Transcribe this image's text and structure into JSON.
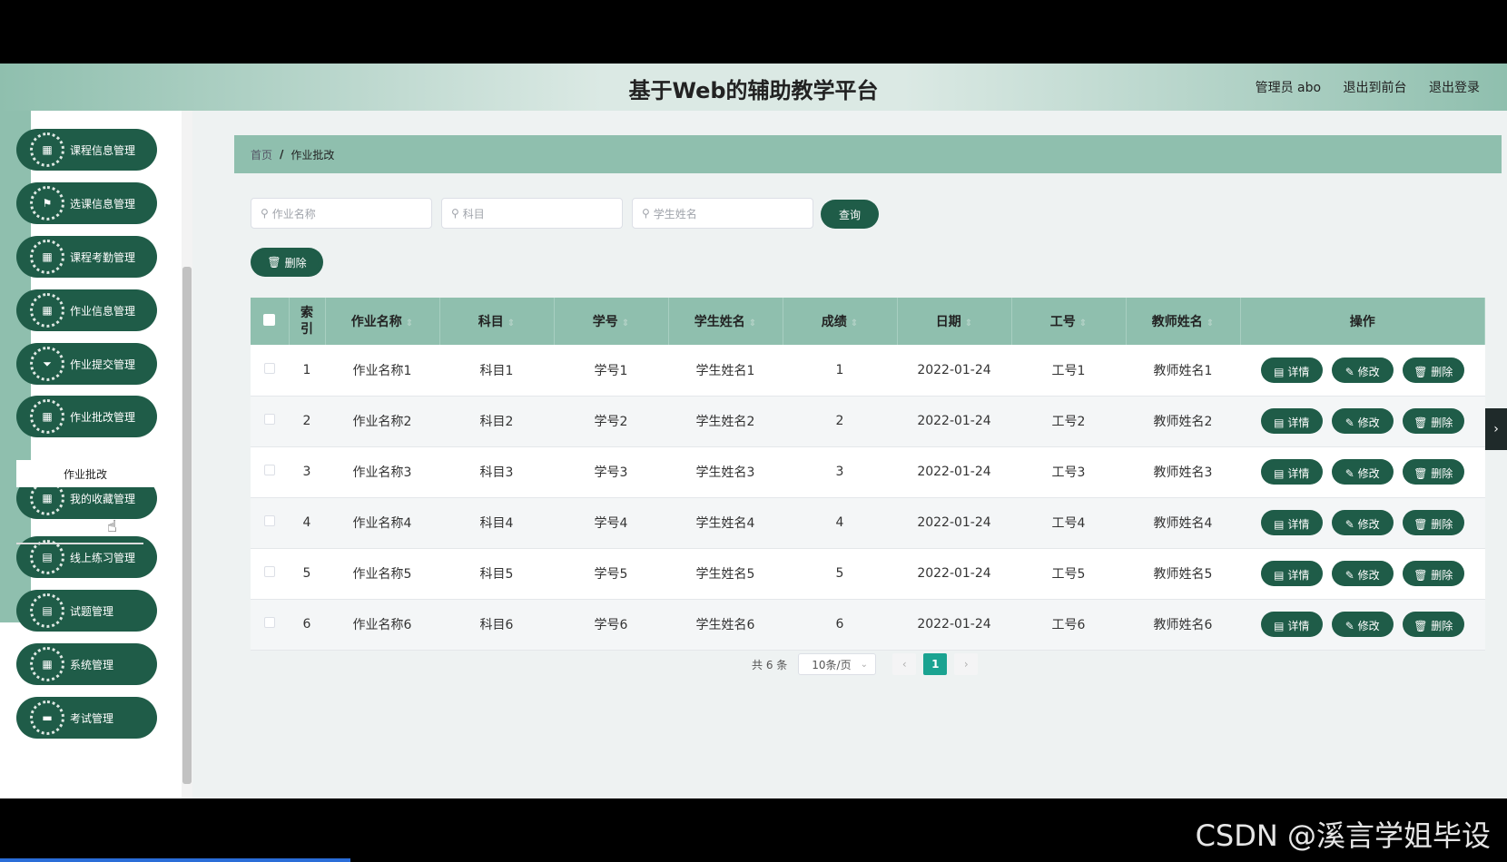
{
  "header": {
    "title": "基于Web的辅助教学平台",
    "user": "管理员 abo",
    "exit_front": "退出到前台",
    "logout": "退出登录"
  },
  "sidebar": {
    "items": [
      {
        "label": "课程信息管理",
        "icon": "grid-icon"
      },
      {
        "label": "选课信息管理",
        "icon": "flag-icon"
      },
      {
        "label": "课程考勤管理",
        "icon": "grid-icon"
      },
      {
        "label": "作业信息管理",
        "icon": "grid-icon"
      },
      {
        "label": "作业提交管理",
        "icon": "funnel-icon"
      },
      {
        "label": "作业批改管理",
        "icon": "grid-icon"
      },
      {
        "label": "我的收藏管理",
        "icon": "grid-icon"
      },
      {
        "label": "线上练习管理",
        "icon": "clipboard-icon"
      },
      {
        "label": "试题管理",
        "icon": "clipboard-icon"
      },
      {
        "label": "系统管理",
        "icon": "grid-icon"
      },
      {
        "label": "考试管理",
        "icon": "monitor-icon"
      }
    ],
    "sub_item": "作业批改"
  },
  "breadcrumb": {
    "home": "首页",
    "separator": "/",
    "current": "作业批改"
  },
  "search": {
    "name_placeholder": "作业名称",
    "subject_placeholder": "科目",
    "student_placeholder": "学生姓名",
    "query_label": "查询",
    "delete_label": "删除"
  },
  "table": {
    "headers": {
      "index": "索引",
      "name": "作业名称",
      "subject": "科目",
      "student_no": "学号",
      "student_name": "学生姓名",
      "score": "成绩",
      "date": "日期",
      "staff_no": "工号",
      "teacher": "教师姓名",
      "actions": "操作"
    },
    "rows": [
      {
        "index": "1",
        "name": "作业名称1",
        "subject": "科目1",
        "student_no": "学号1",
        "student_name": "学生姓名1",
        "score": "1",
        "date": "2022-01-24",
        "staff_no": "工号1",
        "teacher": "教师姓名1"
      },
      {
        "index": "2",
        "name": "作业名称2",
        "subject": "科目2",
        "student_no": "学号2",
        "student_name": "学生姓名2",
        "score": "2",
        "date": "2022-01-24",
        "staff_no": "工号2",
        "teacher": "教师姓名2"
      },
      {
        "index": "3",
        "name": "作业名称3",
        "subject": "科目3",
        "student_no": "学号3",
        "student_name": "学生姓名3",
        "score": "3",
        "date": "2022-01-24",
        "staff_no": "工号3",
        "teacher": "教师姓名3"
      },
      {
        "index": "4",
        "name": "作业名称4",
        "subject": "科目4",
        "student_no": "学号4",
        "student_name": "学生姓名4",
        "score": "4",
        "date": "2022-01-24",
        "staff_no": "工号4",
        "teacher": "教师姓名4"
      },
      {
        "index": "5",
        "name": "作业名称5",
        "subject": "科目5",
        "student_no": "学号5",
        "student_name": "学生姓名5",
        "score": "5",
        "date": "2022-01-24",
        "staff_no": "工号5",
        "teacher": "教师姓名5"
      },
      {
        "index": "6",
        "name": "作业名称6",
        "subject": "科目6",
        "student_no": "学号6",
        "student_name": "学生姓名6",
        "score": "6",
        "date": "2022-01-24",
        "staff_no": "工号6",
        "teacher": "教师姓名6"
      }
    ],
    "actions": {
      "detail": "详情",
      "edit": "修改",
      "delete": "删除"
    }
  },
  "pagination": {
    "total": "共 6 条",
    "page_size": "10条/页",
    "current_page": "1"
  },
  "watermark": "CSDN @溪言学姐毕设",
  "colors": {
    "primary": "#1f5c48",
    "accent": "#8fbfae",
    "page_active": "#1aa391"
  }
}
